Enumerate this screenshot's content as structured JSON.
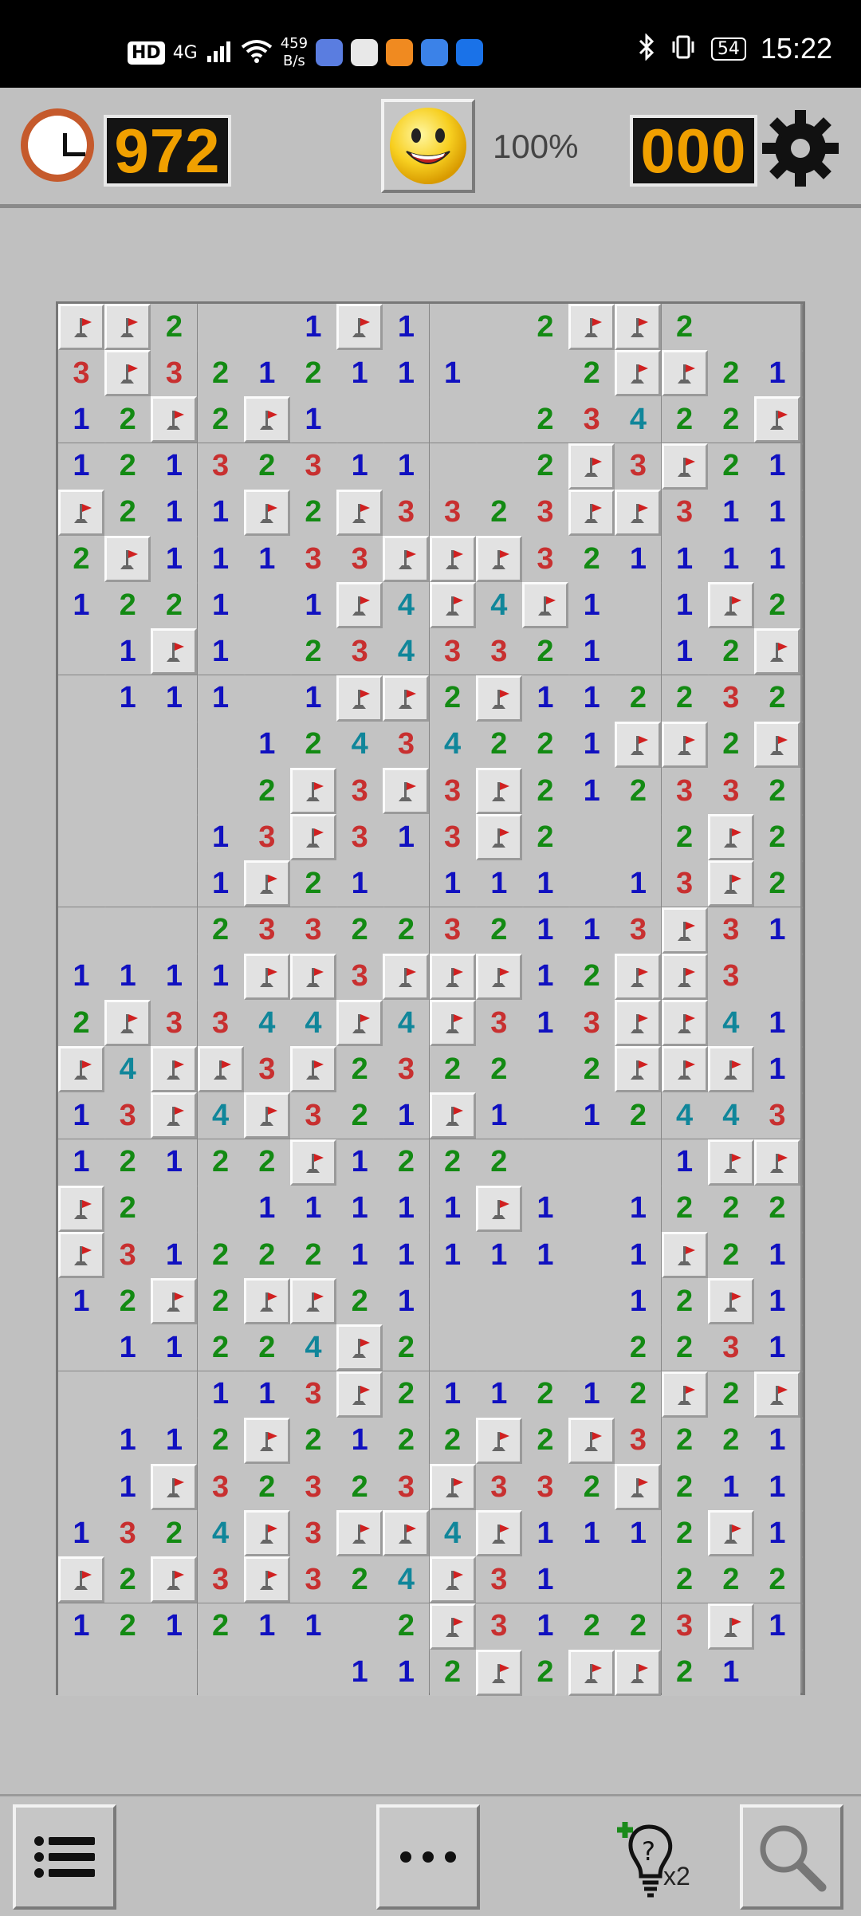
{
  "status_bar": {
    "hd_badge": "HD",
    "network": "4G",
    "speed_value": "459",
    "speed_unit": "B/s",
    "battery": "54",
    "time": "15:22",
    "icons": [
      "hd-icon",
      "signal-icon",
      "wifi-icon",
      "music-app-icon",
      "gift-app-icon",
      "video-app-icon",
      "browser-app-icon",
      "tips-app-icon",
      "bluetooth-icon",
      "vibrate-icon",
      "battery-icon"
    ]
  },
  "header": {
    "timer": "972",
    "zoom": "100%",
    "mine_counter": "000",
    "face": "smiley-happy"
  },
  "board": {
    "cols": 16,
    "rows": 30,
    "legend": "F = flag, . = opened empty, digit = number",
    "cells": [
      "FF2..1F1..2FF2..",
      "3F3212111..2FF211",
      "12F2F1....2342 2F",
      "1213231 1..2F3F21",
      "F211F2F3323F F311.",
      "2F111 33FFF32111 1",
      "1221.1F4F4F1.1F2",
      ".1F1.2343321.12F",
      ".111.1FF2F1122 32",
      "....124342 21FF2F",
      "....2F3F3F212332",
      "...13F313F2..2F2",
      "...1F21.111.13F2",
      "...2332232113F31",
      "1111FF3FFF12FF3.",
      "2F3344F4F313FF41",
      "F4FF3F2322.2FFF1",
      "13F4F321F1.12443",
      "1212 2F1222...1FF",
      "F2..11111F1.1222",
      "F3122211111.1F21.",
      "12F2FF21....12F1.",
      ".1122 4F2....2231",
      "...113F21121 2F2F",
      ".112F2122F2F3221",
      ".1F3232 3F3 32F211",
      "1324F3FF4F1112F1",
      "F2F3F324F31..222",
      "121211.2F312 23F1",
      "......112F2FF21"
    ]
  },
  "bottom_bar": {
    "menu": "list-icon",
    "more": "more-icon",
    "hint_count": "x2",
    "search": "magnifier-icon"
  },
  "colors": {
    "number_1": "#1010c0",
    "number_2": "#138a13",
    "number_3": "#c83030",
    "number_4": "#10869a",
    "counter_digits": "#f0a000",
    "flag": "#d02020"
  }
}
